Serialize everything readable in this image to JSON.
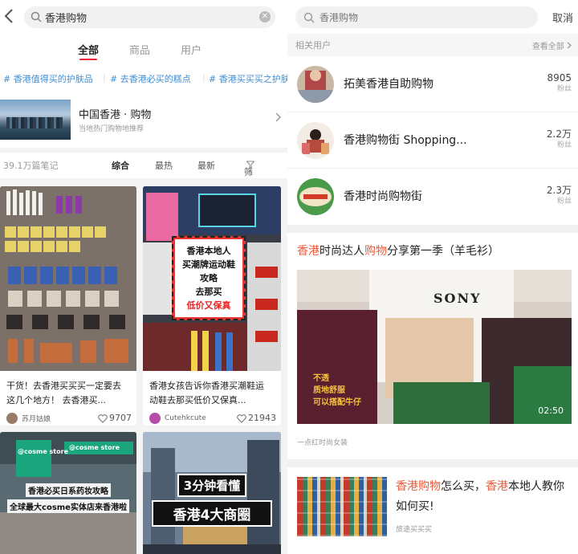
{
  "left": {
    "search_query": "香港购物",
    "tabs": [
      "全部",
      "商品",
      "用户"
    ],
    "topics": [
      "# 香港值得买的护肤品",
      "# 去香港必买的糕点",
      "# 香港买买买之护肤"
    ],
    "place": {
      "name": "中国香港 · 购物",
      "subtitle": "当地热门购物地推荐"
    },
    "sort": {
      "count": "39.1万篇笔记",
      "options": [
        "综合",
        "最热",
        "最新",
        "筛选"
      ]
    },
    "cards": [
      {
        "title": "干货！去香港买买买一定要去这几个地方！ 去香港买...",
        "user": "苏月姑娘",
        "likes": "9707",
        "avatar_color": "#9a7b6a"
      },
      {
        "title": "香港女孩告诉你香港买潮鞋运动鞋去那买低价又保真...",
        "user": "Cutehkcute",
        "likes": "21943",
        "avatar_color": "#b34da8",
        "overlay": [
          "香港本地人",
          "买潮牌运动鞋",
          "攻略",
          "去那买",
          "低价又保真"
        ]
      },
      {
        "overlay": [
          "香港必买日系药妆攻略",
          "全球最大cosme实体店来香港啦"
        ],
        "signs": [
          "@cosme store",
          "@cosme store"
        ]
      },
      {
        "overlay": [
          "3分钟看懂",
          "香港4大商圈"
        ]
      }
    ]
  },
  "right": {
    "search_placeholder": "香港购物",
    "cancel": "取消",
    "related_label": "相关用户",
    "view_all": "查看全部",
    "users": [
      {
        "name": "拓美香港自助购物",
        "fans": "8905",
        "fans_label": "粉丝"
      },
      {
        "name": "香港购物街 Shopping...",
        "fans": "2.2万",
        "fans_label": "粉丝"
      },
      {
        "name": "香港时尚购物街",
        "fans": "2.3万",
        "fans_label": "粉丝"
      }
    ],
    "video": {
      "title_parts": [
        "香港",
        "时尚达人",
        "购物",
        "分享第一季（羊毛衫）"
      ],
      "duration": "02:50",
      "shirt_text": "SONY",
      "caption": [
        "不透",
        "质地舒服",
        "可以搭配牛仔"
      ],
      "source": "一点红时尚女装"
    },
    "article": {
      "title_parts": [
        "香港购物",
        "怎么买，",
        "香港",
        "本地人教你如何买!"
      ],
      "source": "旅途买买买"
    }
  },
  "colors": {
    "accent_red": "#e23",
    "highlight": "#ef5b3a",
    "topic_blue": "#3e8ed8"
  }
}
